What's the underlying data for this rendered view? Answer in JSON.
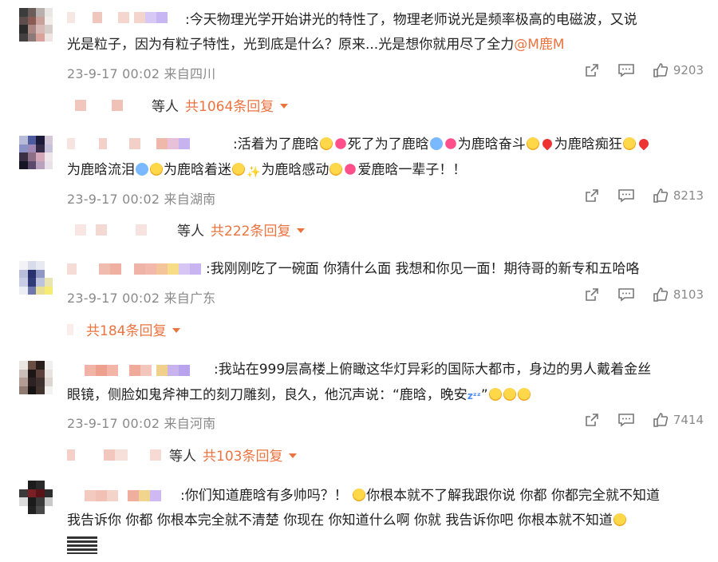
{
  "comments": [
    {
      "text_a": ":今天物理光学开始讲光的特性了，物理老师说光是频率极高的电磁波，又说",
      "text_b": "光是粒子，因为有粒子特性，光到底是什么？原来...光是想你就用尽了全力",
      "mention": "@M鹿M",
      "time": "23-9-17 00:02",
      "location": "来自四川",
      "likes": "9203",
      "reply_prefix": "等人",
      "reply_count": "共1064条回复"
    },
    {
      "text_a": ":活着为了鹿晗",
      "text_a2": "死了为了鹿晗",
      "text_a3": "为鹿晗奋斗",
      "text_a4": "为鹿晗痴狂",
      "text_b1": "为鹿晗流泪",
      "text_b2": "为鹿晗着迷",
      "text_b3": "为鹿晗感动",
      "text_b4": "爱鹿晗一辈子！！",
      "time": "23-9-17 00:02",
      "location": "来自湖南",
      "likes": "8213",
      "reply_prefix": "等人",
      "reply_count": "共222条回复"
    },
    {
      "text_a": ":我刚刚吃了一碗面 你猜什么面 我想和你见一面！期待哥的新专和五哈咯",
      "time": "23-9-17 00:02",
      "location": "来自广东",
      "likes": "8103",
      "reply_count": "共184条回复"
    },
    {
      "text_a": ":我站在999层高楼上俯瞰这华灯异彩的国际大都市，身边的男人戴着金丝",
      "text_b": "眼镜，侧脸如鬼斧神工的刻刀雕刻，良久，他沉声说：“鹿晗，晚安",
      "time": "23-9-17 00:02",
      "location": "来自河南",
      "likes": "7414",
      "reply_prefix": "等人",
      "reply_count": "共103条回复"
    },
    {
      "text_a": ":你们知道鹿晗有多帅吗？！",
      "text_a2": "你根本就不了解我跟你说 你都 你都完全就不知道",
      "text_b": "我告诉你 你都 你根本完全就不清楚 你现在 你知道什么啊 你就 我告诉你吧 你根本就不知道"
    }
  ],
  "icons": [
    "share-icon",
    "comment-icon",
    "like-icon"
  ],
  "colors": {
    "accent": "#eb7340",
    "meta": "#8a8a8a"
  }
}
